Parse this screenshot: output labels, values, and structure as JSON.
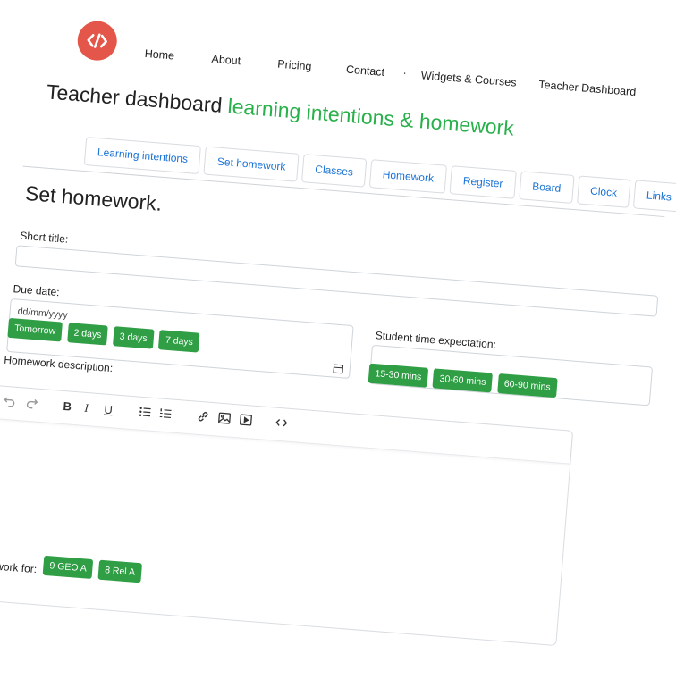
{
  "nav": {
    "items": [
      "Home",
      "About",
      "Pricing",
      "Contact",
      "Widgets & Courses",
      "Teacher Dashboard"
    ],
    "separator": "."
  },
  "title": {
    "main": "Teacher dashboard",
    "accent": "learning intentions & homework"
  },
  "tabs": [
    "Learning intentions",
    "Set homework",
    "Classes",
    "Homework",
    "Register",
    "Board",
    "Clock",
    "Links"
  ],
  "form": {
    "heading": "Set homework.",
    "short_title_label": "Short title:",
    "short_title_value": "",
    "due_date_label": "Due date:",
    "due_date_placeholder": "dd/mm/yyyy",
    "due_buttons": [
      "Tomorrow",
      "2 days",
      "3 days",
      "7 days"
    ],
    "student_time_label": "Student time expectation:",
    "student_time_value": "",
    "time_buttons": [
      "15-30 mins",
      "30-60 mins",
      "60-90 mins"
    ],
    "description_label": "Homework description:",
    "homework_for_label": "homework for:",
    "class_buttons": [
      "9 GEO A",
      "8 Rel A"
    ]
  },
  "editor_toolbar": [
    "undo-icon",
    "redo-icon",
    "bold-icon",
    "italic-icon",
    "underline-icon",
    "bullet-list-icon",
    "numbered-list-icon",
    "link-icon",
    "image-icon",
    "video-icon",
    "code-icon"
  ],
  "colors": {
    "accent_green": "#28b04a",
    "button_green": "#2f9e44",
    "link_blue": "#1a73d6",
    "logo_red": "#e4564a"
  }
}
